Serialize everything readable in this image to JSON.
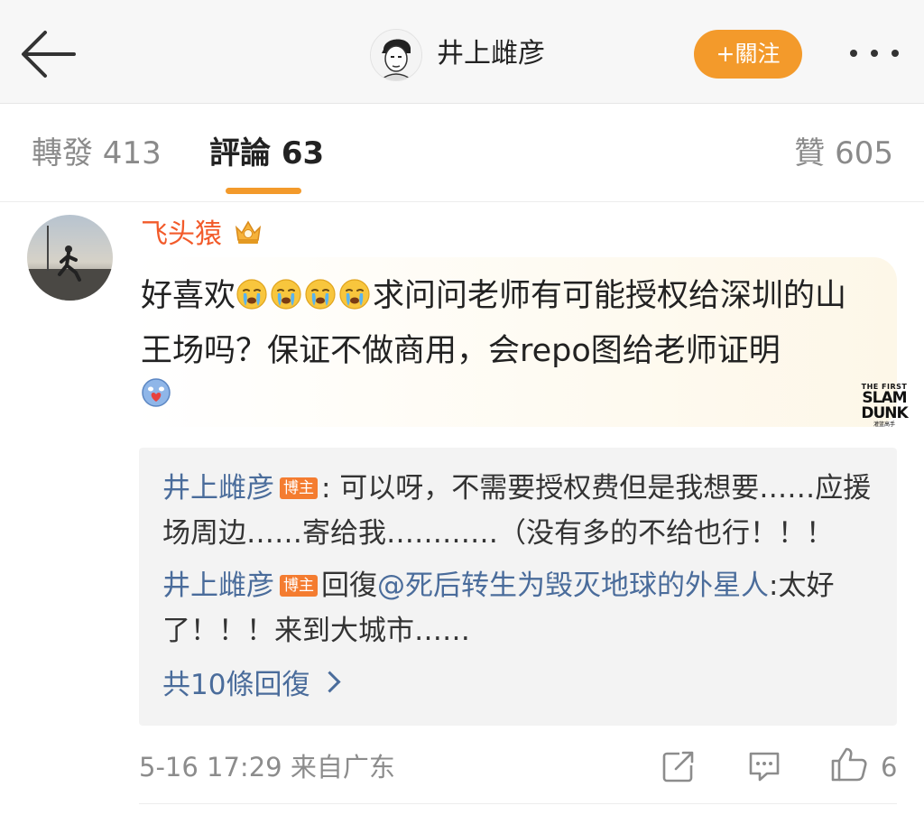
{
  "header": {
    "back_icon": "arrow-left-icon",
    "author_name": "井上雌彦",
    "follow_label": "+關注",
    "more_icon": "more-dots-icon"
  },
  "tabs": {
    "reposts": "轉發 413",
    "comments": "評論 63",
    "likes": "贊 605"
  },
  "comment": {
    "author": "飞头猿",
    "crown_icon": "crown-badge-icon",
    "text_before": "好喜欢",
    "emoji_icon": "crying-face-icon",
    "emoji_count": 4,
    "text_after": "求问问老师有可能授权给深圳的山王场吗？保证不做商用，会repo图给老师证明",
    "trailing_emoji_icon": "blue-heart-face-icon",
    "card_logo": {
      "line1": "THE FIRST",
      "line2": "SLAM",
      "line3": "DUNK",
      "line4": "灌篮高手"
    },
    "timestamp": "5-16 17:29",
    "location": "来自广东",
    "like_count": "6"
  },
  "replies": {
    "items": [
      {
        "author": "井上雌彦",
        "badge": "博主",
        "text": ": 可以呀，不需要授权费但是我想要……应援场周边……寄给我…………（没有多的不给也行！！！"
      },
      {
        "author": "井上雌彦",
        "badge": "博主",
        "reply_prefix": "回復",
        "mention": "@死后转生为毁灭地球的外星人",
        "text": ":太好了！！！来到大城市……"
      }
    ],
    "more_label": "共10條回復"
  },
  "colors": {
    "accent": "#f39a2b",
    "username": "#f25a2a",
    "link": "#4a6c9b",
    "badge": "#f47c30"
  }
}
